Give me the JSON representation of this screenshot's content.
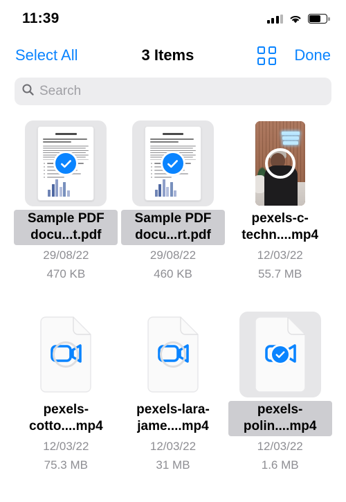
{
  "status_bar": {
    "time": "11:39",
    "signal_icon": "cellular-signal-icon",
    "wifi_icon": "wifi-icon",
    "battery_icon": "battery-icon"
  },
  "nav_bar": {
    "select_all_label": "Select All",
    "title": "3 Items",
    "grid_view_icon": "grid-view-icon",
    "done_label": "Done"
  },
  "search": {
    "placeholder": "Search",
    "value": "",
    "icon": "search-icon"
  },
  "colors": {
    "accent_blue": "#0a84ff",
    "selection_gray": "#cdcdd1",
    "thumb_selection_gray": "#e6e6e8",
    "meta_gray": "#8e8e93",
    "search_bg": "#ededef"
  },
  "files": [
    {
      "name": "Sample PDF docu...t.pdf",
      "date": "29/08/22",
      "size": "470 KB",
      "kind": "pdf",
      "selected": true
    },
    {
      "name": "Sample PDF docu...rt.pdf",
      "date": "29/08/22",
      "size": "460 KB",
      "kind": "pdf",
      "selected": true
    },
    {
      "name": "pexels-c-techn....mp4",
      "date": "12/03/22",
      "size": "55.7 MB",
      "kind": "video-photo",
      "selected": false
    },
    {
      "name": "pexels-cotto....mp4",
      "date": "12/03/22",
      "size": "75.3 MB",
      "kind": "video-doc",
      "selected": false
    },
    {
      "name": "pexels-lara-jame....mp4",
      "date": "12/03/22",
      "size": "31 MB",
      "kind": "video-doc",
      "selected": false
    },
    {
      "name": "pexels-polin....mp4",
      "date": "12/03/22",
      "size": "1.6 MB",
      "kind": "video-doc",
      "selected": true
    }
  ]
}
